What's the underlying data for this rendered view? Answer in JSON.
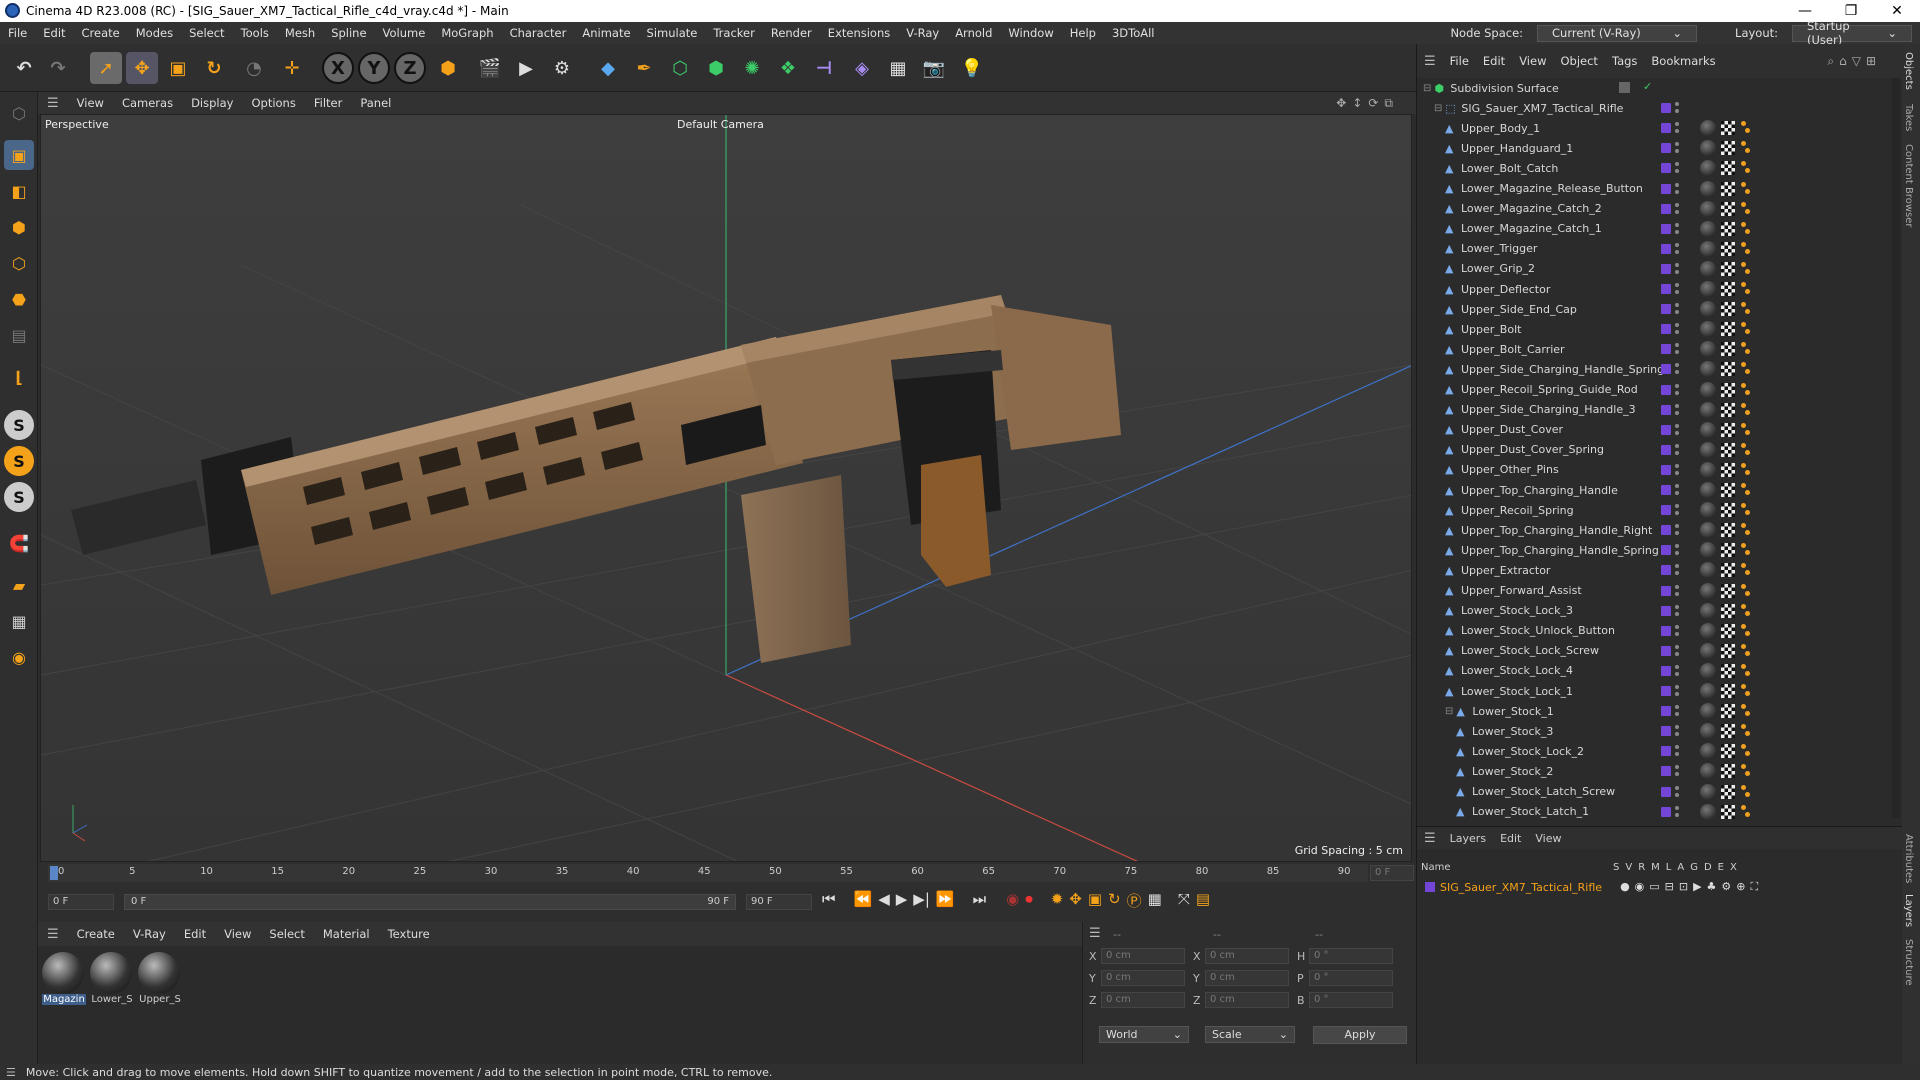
{
  "title": "Cinema 4D R23.008 (RC) - [SIG_Sauer_XM7_Tactical_Rifle_c4d_vray.c4d *] - Main",
  "window_controls": [
    "—",
    "❐",
    "✕"
  ],
  "menu": [
    "File",
    "Edit",
    "Create",
    "Modes",
    "Select",
    "Tools",
    "Mesh",
    "Spline",
    "Volume",
    "MoGraph",
    "Character",
    "Animate",
    "Simulate",
    "Tracker",
    "Render",
    "Extensions",
    "V-Ray",
    "Arnold",
    "Window",
    "Help",
    "3DToAll"
  ],
  "node_space": {
    "label": "Node Space:",
    "value": "Current (V-Ray)"
  },
  "layout": {
    "label": "Layout:",
    "value": "Startup (User)"
  },
  "viewport_menu": [
    "View",
    "Cameras",
    "Display",
    "Options",
    "Filter",
    "Panel"
  ],
  "viewport": {
    "name": "Perspective",
    "camera": "Default Camera",
    "grid_spacing": "Grid Spacing : 5 cm"
  },
  "timeline": {
    "ticks": [
      "0",
      "5",
      "10",
      "15",
      "20",
      "25",
      "30",
      "35",
      "40",
      "45",
      "50",
      "55",
      "60",
      "65",
      "70",
      "75",
      "80",
      "85",
      "90"
    ],
    "end_frame": "0 F",
    "start_field": "0 F",
    "range_start": "0 F",
    "range_end": "90 F",
    "max_field": "90 F"
  },
  "material_menu": [
    "Create",
    "V-Ray",
    "Edit",
    "View",
    "Select",
    "Material",
    "Texture"
  ],
  "materials": [
    {
      "label": "Magazin"
    },
    {
      "label": "Lower_S"
    },
    {
      "label": "Upper_S"
    }
  ],
  "coords": {
    "headers": [
      "--",
      "--",
      "--"
    ],
    "rows": [
      {
        "a": "X",
        "av": "0 cm",
        "b": "X",
        "bv": "0 cm",
        "c": "H",
        "cv": "0 °"
      },
      {
        "a": "Y",
        "av": "0 cm",
        "b": "Y",
        "bv": "0 cm",
        "c": "P",
        "cv": "0 °"
      },
      {
        "a": "Z",
        "av": "0 cm",
        "b": "Z",
        "bv": "0 cm",
        "c": "B",
        "cv": "0 °"
      }
    ],
    "world": "World",
    "scale": "Scale",
    "apply": "Apply"
  },
  "status": "Move: Click and drag to move elements. Hold down SHIFT to quantize movement / add to the selection in point mode, CTRL to remove.",
  "object_menu": [
    "File",
    "Edit",
    "View",
    "Object",
    "Tags",
    "Bookmarks"
  ],
  "objects": [
    {
      "name": "Subdivision Surface",
      "indent": 0
    },
    {
      "name": "SIG_Sauer_XM7_Tactical_Rifle",
      "indent": 1
    },
    {
      "name": "Upper_Body_1",
      "indent": 2
    },
    {
      "name": "Upper_Handguard_1",
      "indent": 2
    },
    {
      "name": "Lower_Bolt_Catch",
      "indent": 2
    },
    {
      "name": "Lower_Magazine_Release_Button",
      "indent": 2
    },
    {
      "name": "Lower_Magazine_Catch_2",
      "indent": 2
    },
    {
      "name": "Lower_Magazine_Catch_1",
      "indent": 2
    },
    {
      "name": "Lower_Trigger",
      "indent": 2
    },
    {
      "name": "Lower_Grip_2",
      "indent": 2
    },
    {
      "name": "Upper_Deflector",
      "indent": 2
    },
    {
      "name": "Upper_Side_End_Cap",
      "indent": 2
    },
    {
      "name": "Upper_Bolt",
      "indent": 2
    },
    {
      "name": "Upper_Bolt_Carrier",
      "indent": 2
    },
    {
      "name": "Upper_Side_Charging_Handle_Spring",
      "indent": 2
    },
    {
      "name": "Upper_Recoil_Spring_Guide_Rod",
      "indent": 2
    },
    {
      "name": "Upper_Side_Charging_Handle_3",
      "indent": 2
    },
    {
      "name": "Upper_Dust_Cover",
      "indent": 2
    },
    {
      "name": "Upper_Dust_Cover_Spring",
      "indent": 2
    },
    {
      "name": "Upper_Other_Pins",
      "indent": 2
    },
    {
      "name": "Upper_Top_Charging_Handle",
      "indent": 2
    },
    {
      "name": "Upper_Recoil_Spring",
      "indent": 2
    },
    {
      "name": "Upper_Top_Charging_Handle_Right",
      "indent": 2
    },
    {
      "name": "Upper_Top_Charging_Handle_Spring",
      "indent": 2
    },
    {
      "name": "Upper_Extractor",
      "indent": 2
    },
    {
      "name": "Upper_Forward_Assist",
      "indent": 2
    },
    {
      "name": "Lower_Stock_Lock_3",
      "indent": 2
    },
    {
      "name": "Lower_Stock_Unlock_Button",
      "indent": 2
    },
    {
      "name": "Lower_Stock_Lock_Screw",
      "indent": 2
    },
    {
      "name": "Lower_Stock_Lock_4",
      "indent": 2
    },
    {
      "name": "Lower_Stock_Lock_1",
      "indent": 2
    },
    {
      "name": "Lower_Stock_1",
      "indent": 2
    },
    {
      "name": "Lower_Stock_3",
      "indent": 3
    },
    {
      "name": "Lower_Stock_Lock_2",
      "indent": 3
    },
    {
      "name": "Lower_Stock_2",
      "indent": 3
    },
    {
      "name": "Lower_Stock_Latch_Screw",
      "indent": 3
    },
    {
      "name": "Lower_Stock_Latch_1",
      "indent": 3
    }
  ],
  "layers_menu": [
    "Layers",
    "Edit",
    "View"
  ],
  "layers_header": {
    "name": "Name",
    "cols": [
      "S",
      "V",
      "R",
      "M",
      "L",
      "A",
      "G",
      "D",
      "E",
      "X"
    ]
  },
  "layers": [
    {
      "name": "SIG_Sauer_XM7_Tactical_Rifle",
      "color": "#7446d8"
    }
  ],
  "right_tabs": [
    "Objects",
    "Takes",
    "Content Browser",
    "Attributes",
    "Layers",
    "Structure"
  ],
  "colors": {
    "accent": "#f0a020",
    "object_layer": "#7446d8",
    "active_icon": "#f4a21a"
  }
}
